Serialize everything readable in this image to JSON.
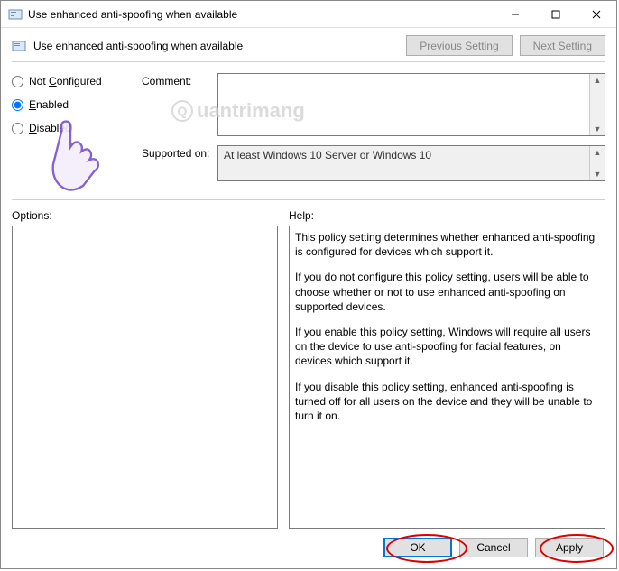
{
  "window": {
    "title": "Use enhanced anti-spoofing when available"
  },
  "header": {
    "policy_title": "Use enhanced anti-spoofing when available",
    "prev": "Previous Setting",
    "next": "Next Setting"
  },
  "state": {
    "not_configured": "Not Configured",
    "enabled": "Enabled",
    "disabled": "Disabled",
    "selected": "enabled"
  },
  "labels": {
    "comment": "Comment:",
    "supported": "Supported on:",
    "options": "Options:",
    "help": "Help:"
  },
  "comment_value": "",
  "supported_on": "At least Windows 10 Server or Windows 10",
  "help": {
    "p1": "This policy setting determines whether enhanced anti-spoofing is configured for devices which support it.",
    "p2": "If you do not configure this policy setting, users will be able to choose whether or not to use enhanced anti-spoofing on supported devices.",
    "p3": "If you enable this policy setting, Windows will require all users on the device to use anti-spoofing for facial features, on devices which support it.",
    "p4": "If you disable this policy setting, enhanced anti-spoofing is turned off for all users on the device and they will be unable to turn it on."
  },
  "buttons": {
    "ok": "OK",
    "cancel": "Cancel",
    "apply": "Apply"
  },
  "watermark": "uantrimang"
}
